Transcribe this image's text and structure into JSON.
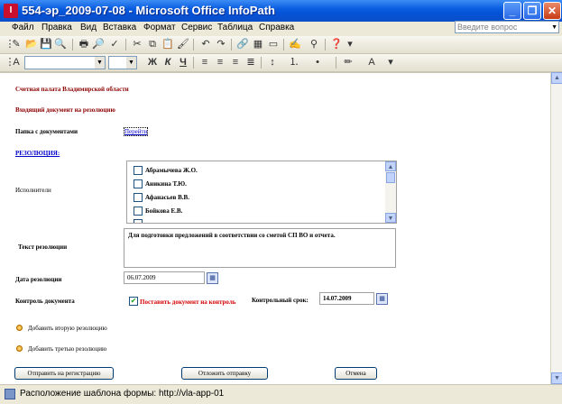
{
  "window": {
    "title": "554-эр_2009-07-08 - Microsoft Office InfoPath",
    "minimize": "_",
    "maximize": "❐",
    "close": "✕"
  },
  "menu": {
    "items": [
      "Файл",
      "Правка",
      "Вид",
      "Вставка",
      "Формат",
      "Сервис",
      "Таблица",
      "Справка"
    ],
    "help_placeholder": "Введите вопрос"
  },
  "formatting": {
    "bold": "Ж",
    "italic": "К",
    "underline": "Ч"
  },
  "form": {
    "org_title": "Счетная палата Владимирской области",
    "doc_heading": "Входящий документ на резолюцию",
    "folder_label": "Папка с документами",
    "folder_link": "Перейти",
    "resolution_heading": "РЕЗОЛЮЦИЯ:",
    "executors_label": "Исполнители",
    "executors": [
      "Абрамычева Ж.О.",
      "Аникина Т.Ю.",
      "Афанасьев В.В.",
      "Бойкова Е.В."
    ],
    "resolution_text_label": "Текст резолюции",
    "resolution_text": "Для подготовки предложений в соответствии со сметой СП ВО и отчета.",
    "date_label": "Дата резолюции",
    "date_value": "06.07.2009",
    "control_label": "Контроль документа",
    "control_checkbox_label": "Поставить документ на контроль",
    "control_checked": true,
    "deadline_label": "Контрольный срок:",
    "deadline_value": "14.07.2009",
    "add_second": "Добавить вторую резолюцию",
    "add_third": "Добавить третью резолюцию",
    "btn_send": "Отправить на регистрацию",
    "btn_postpone": "Отложить отправку",
    "btn_cancel": "Отмена"
  },
  "status": {
    "text": "Расположение шаблона формы: http://vla-app-01"
  },
  "colors": {
    "title_bar": "#0a5ee0",
    "dark_red_text": "#8b0000",
    "link": "#0000cc"
  }
}
